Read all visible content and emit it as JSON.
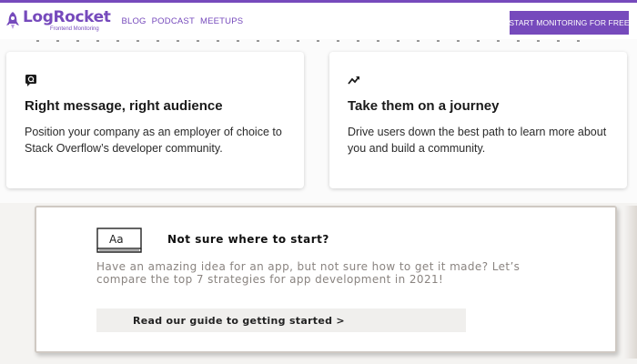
{
  "header": {
    "logo_name": "LogRocket",
    "logo_tagline": "Frontend Monitoring",
    "nav": [
      "BLOG",
      "PODCAST",
      "MEETUPS"
    ],
    "cta_label": "START MONITORING FOR FREE"
  },
  "cards": [
    {
      "icon": "chat-question-icon",
      "title": "Right message, right audience",
      "body": "Position your company as an employer of choice to Stack Overflow’s developer community."
    },
    {
      "icon": "trending-up-icon",
      "title": "Take them on a journey",
      "body": "Drive users down the best path to learn more about you and build a community."
    }
  ],
  "guide": {
    "book_label": "Aa",
    "title": "Not sure where to start?",
    "body": "Have an amazing idea for an app, but not sure how to get it made? Let’s compare the top 7 strategies for app development in 2021!",
    "button_label": "Read our guide to getting started >"
  },
  "colors": {
    "brand": "#764abc",
    "page_bg": "#f4f3f1"
  }
}
